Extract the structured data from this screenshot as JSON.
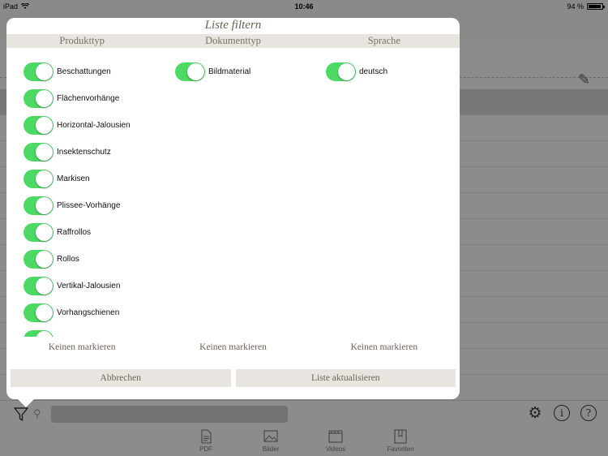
{
  "statusbar": {
    "device": "iPad",
    "time": "10:46",
    "battery": "94 %"
  },
  "popover": {
    "title": "Liste filtern",
    "columns": [
      {
        "header": "Produkttyp",
        "items": [
          "Beschattungen",
          "Flächenvorhänge",
          "Horizontal-Jalousien",
          "Insektenschutz",
          "Markisen",
          "Plissee-Vorhänge",
          "Raffrollos",
          "Rollos",
          "Vertikal-Jalousien",
          "Vorhangschienen"
        ],
        "deselect": "Keinen markieren"
      },
      {
        "header": "Dokumenttyp",
        "items": [
          "Bildmaterial"
        ],
        "deselect": "Keinen markieren"
      },
      {
        "header": "Sprache",
        "items": [
          "deutsch"
        ],
        "deselect": "Keinen markieren"
      }
    ],
    "cancel_label": "Abbrechen",
    "apply_label": "Liste aktualisieren"
  },
  "tabbar": {
    "items": [
      {
        "label": "PDF",
        "icon": "pdf-icon"
      },
      {
        "label": "Bilder",
        "icon": "image-icon"
      },
      {
        "label": "Videos",
        "icon": "video-icon"
      },
      {
        "label": "Favoriten",
        "icon": "bookmark-icon"
      }
    ]
  },
  "colors": {
    "toggle_on": "#4cd964",
    "header_bg": "#e8e4df",
    "accent_text": "#6f6558"
  }
}
